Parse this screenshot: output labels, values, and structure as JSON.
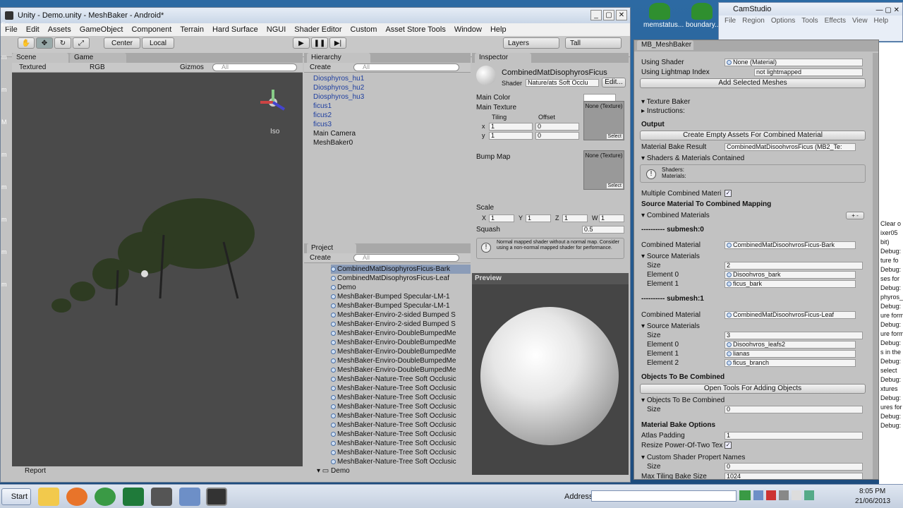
{
  "desktop": {
    "icons": [
      {
        "label": "memstatus..."
      },
      {
        "label": "boundary..."
      }
    ],
    "right_text": [
      "Clear o",
      "ixer05",
      "bit)",
      "Debug:",
      "ture fo",
      "Debug:",
      "ses for",
      "Debug:",
      "phyros_",
      "Debug:",
      "ure form",
      "Debug:",
      "ure form",
      "Debug:",
      "s in the",
      "Debug:",
      "select",
      "Debug:",
      "xtures",
      "Debug:",
      "ures for",
      "Debug:",
      "Debug:"
    ],
    "left_text": [
      "Fa",
      "m",
      "m",
      "M",
      "m",
      "m",
      "m",
      "m",
      "m"
    ]
  },
  "camstudio": {
    "title": "CamStudio",
    "menu": [
      "File",
      "Region",
      "Options",
      "Tools",
      "Effects",
      "View",
      "Help"
    ]
  },
  "unity": {
    "title": "Unity - Demo.unity - MeshBaker - Android*",
    "menu": [
      "File",
      "Edit",
      "Assets",
      "GameObject",
      "Component",
      "Terrain",
      "Hard Surface",
      "NGUI",
      "Shader Editor",
      "Custom",
      "Asset Store Tools",
      "Window",
      "Help"
    ],
    "toolbar": {
      "center": "Center",
      "local": "Local",
      "layers": "Layers",
      "layout": "Tall"
    },
    "scene": {
      "tab_scene": "Scene",
      "tab_game": "Game",
      "render_mode": "Textured",
      "color_mode": "RGB",
      "gizmos": "Gizmos",
      "search": "All",
      "iso": "Iso",
      "report": "Report"
    },
    "hierarchy": {
      "tab": "Hierarchy",
      "create": "Create",
      "search": "All",
      "items": [
        {
          "label": "Diosphyros_hu1",
          "blue": true
        },
        {
          "label": "Diosphyros_hu2",
          "blue": true
        },
        {
          "label": "Diosphyros_hu3",
          "blue": true
        },
        {
          "label": "ficus1",
          "blue": true
        },
        {
          "label": "ficus2",
          "blue": true
        },
        {
          "label": "ficus3",
          "blue": true
        },
        {
          "label": "Main Camera",
          "blue": false
        },
        {
          "label": "MeshBaker0",
          "blue": false
        }
      ]
    },
    "project": {
      "tab": "Project",
      "create": "Create",
      "search": "All",
      "items": [
        "CombinedMatDisophyrosFicus-Bark",
        "CombinedMatDisophyrosFicus-Leaf",
        "Demo",
        "MeshBaker-Bumped Specular-LM-1",
        "MeshBaker-Bumped Specular-LM-1",
        "MeshBaker-Enviro-2-sided Bumped S",
        "MeshBaker-Enviro-2-sided Bumped S",
        "MeshBaker-Enviro-DoubleBumpedMe",
        "MeshBaker-Enviro-DoubleBumpedMe",
        "MeshBaker-Enviro-DoubleBumpedMe",
        "MeshBaker-Enviro-DoubleBumpedMe",
        "MeshBaker-Enviro-DoubleBumpedMe",
        "MeshBaker-Nature-Tree Soft Occlusic",
        "MeshBaker-Nature-Tree Soft Occlusic",
        "MeshBaker-Nature-Tree Soft Occlusic",
        "MeshBaker-Nature-Tree Soft Occlusic",
        "MeshBaker-Nature-Tree Soft Occlusic",
        "MeshBaker-Nature-Tree Soft Occlusic",
        "MeshBaker-Nature-Tree Soft Occlusic",
        "MeshBaker-Nature-Tree Soft Occlusic",
        "MeshBaker-Nature-Tree Soft Occlusic",
        "MeshBaker-Nature-Tree Soft Occlusic"
      ],
      "folder": "Demo"
    },
    "inspector": {
      "tab": "Inspector",
      "material_name": "CombinedMatDisophyrosFicus",
      "shader_label": "Shader",
      "shader_value": "Nature/ats Soft Occlu",
      "edit": "Edit...",
      "main_color": "Main Color",
      "main_texture": "Main Texture",
      "tiling": "Tiling",
      "offset": "Offset",
      "x": "x",
      "y": "y",
      "tile_x": "1",
      "tile_y": "1",
      "off_x": "0",
      "off_y": "0",
      "none_texture": "None (Texture)",
      "select": "Select",
      "bump_map": "Bump Map",
      "scale": "Scale",
      "X": "X",
      "Y": "Y",
      "Z": "Z",
      "W": "W",
      "scale_x": "1",
      "scale_y": "1",
      "scale_z": "1",
      "scale_w": "1",
      "squash": "Squash",
      "squash_value": "0.5",
      "warning": "Normal mapped shader without a normal map. Consider using a non-normal mapped shader for performance.",
      "preview": "Preview"
    }
  },
  "meshbaker": {
    "tab": "MB_MeshBaker",
    "using_shader_label": "Using Shader",
    "using_shader_value": "None (Material)",
    "lightmap_label": "Using Lightmap Index",
    "lightmap_value": "not lightmapped",
    "add_selected": "Add Selected Meshes",
    "texture_baker": "Texture Baker",
    "instructions": "Instructions:",
    "output": "Output",
    "create_assets": "Create Empty Assets For Combined Material",
    "bake_result_label": "Material Bake Result",
    "bake_result_value": "CombinedMatDisoohvrosFicus (MB2_Te:",
    "shaders_contained": "Shaders & Materials Contained",
    "shaders": "Shaders:",
    "materials": "Materials:",
    "multiple": "Multiple Combined Materi",
    "mapping": "Source Material To Combined Mapping",
    "combined_materials": "Combined Materials",
    "sub0": "---------- submesh:0",
    "combined_material_label": "Combined Material",
    "cm0": "CombinedMatDisoohvrosFicus-Bark",
    "source_materials": "Source Materials",
    "size": "Size",
    "s0_size": "2",
    "s0": [
      {
        "k": "Element 0",
        "v": "Disoohvros_bark"
      },
      {
        "k": "Element 1",
        "v": "ficus_bark"
      }
    ],
    "sub1": "---------- submesh:1",
    "cm1": "CombinedMatDisoohvrosFicus-Leaf",
    "s1_size": "3",
    "s1": [
      {
        "k": "Element 0",
        "v": "Disoohvros_leafs2"
      },
      {
        "k": "Element 1",
        "v": "lianas"
      },
      {
        "k": "Element 2",
        "v": "ficus_branch"
      }
    ],
    "objects": "Objects To Be Combined",
    "open_tools": "Open Tools For Adding Objects",
    "objects_sub": "Objects To Be Combined",
    "obj_size": "0",
    "bake_options": "Material Bake Options",
    "atlas_padding": "Atlas Padding",
    "atlas_value": "1",
    "resize": "Resize Power-Of-Two Tex",
    "custom_shader": "Custom Shader Propert Names",
    "cs_size": "0",
    "max_tiling": "Max Tiling Bake Size",
    "max_tiling_value": "1024"
  },
  "taskbar": {
    "start": "Start",
    "address": "Address",
    "time": "8:05 PM",
    "date": "21/06/2013"
  }
}
